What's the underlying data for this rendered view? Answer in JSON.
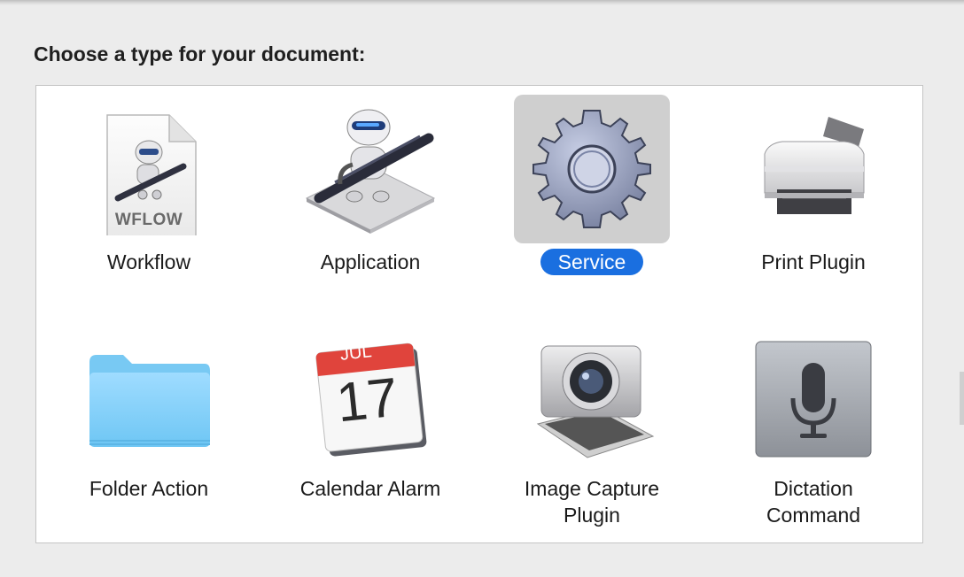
{
  "prompt": "Choose a type for your document:",
  "items": [
    {
      "label": "Workflow",
      "icon": "workflow-document-icon",
      "badge": "WFLOW",
      "selected": false
    },
    {
      "label": "Application",
      "icon": "automator-robot-icon",
      "selected": false
    },
    {
      "label": "Service",
      "icon": "gear-icon",
      "selected": true
    },
    {
      "label": "Print Plugin",
      "icon": "printer-icon",
      "selected": false
    },
    {
      "label": "Folder Action",
      "icon": "folder-icon",
      "selected": false
    },
    {
      "label": "Calendar Alarm",
      "icon": "calendar-icon",
      "month": "JUL",
      "day": "17",
      "selected": false
    },
    {
      "label": "Image Capture\nPlugin",
      "icon": "camera-icon",
      "selected": false
    },
    {
      "label": "Dictation\nCommand",
      "icon": "microphone-icon",
      "selected": false
    }
  ],
  "colors": {
    "selection": "#1a6fe0",
    "selected_tile": "#cfcfcf"
  }
}
